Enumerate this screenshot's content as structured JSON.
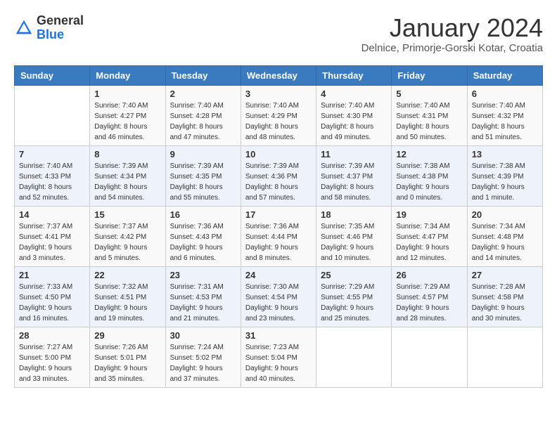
{
  "header": {
    "logo_general": "General",
    "logo_blue": "Blue",
    "month_year": "January 2024",
    "location": "Delnice, Primorje-Gorski Kotar, Croatia"
  },
  "weekdays": [
    "Sunday",
    "Monday",
    "Tuesday",
    "Wednesday",
    "Thursday",
    "Friday",
    "Saturday"
  ],
  "weeks": [
    [
      {
        "day": "",
        "sunrise": "",
        "sunset": "",
        "daylight": ""
      },
      {
        "day": "1",
        "sunrise": "Sunrise: 7:40 AM",
        "sunset": "Sunset: 4:27 PM",
        "daylight": "Daylight: 8 hours and 46 minutes."
      },
      {
        "day": "2",
        "sunrise": "Sunrise: 7:40 AM",
        "sunset": "Sunset: 4:28 PM",
        "daylight": "Daylight: 8 hours and 47 minutes."
      },
      {
        "day": "3",
        "sunrise": "Sunrise: 7:40 AM",
        "sunset": "Sunset: 4:29 PM",
        "daylight": "Daylight: 8 hours and 48 minutes."
      },
      {
        "day": "4",
        "sunrise": "Sunrise: 7:40 AM",
        "sunset": "Sunset: 4:30 PM",
        "daylight": "Daylight: 8 hours and 49 minutes."
      },
      {
        "day": "5",
        "sunrise": "Sunrise: 7:40 AM",
        "sunset": "Sunset: 4:31 PM",
        "daylight": "Daylight: 8 hours and 50 minutes."
      },
      {
        "day": "6",
        "sunrise": "Sunrise: 7:40 AM",
        "sunset": "Sunset: 4:32 PM",
        "daylight": "Daylight: 8 hours and 51 minutes."
      }
    ],
    [
      {
        "day": "7",
        "sunrise": "Sunrise: 7:40 AM",
        "sunset": "Sunset: 4:33 PM",
        "daylight": "Daylight: 8 hours and 52 minutes."
      },
      {
        "day": "8",
        "sunrise": "Sunrise: 7:39 AM",
        "sunset": "Sunset: 4:34 PM",
        "daylight": "Daylight: 8 hours and 54 minutes."
      },
      {
        "day": "9",
        "sunrise": "Sunrise: 7:39 AM",
        "sunset": "Sunset: 4:35 PM",
        "daylight": "Daylight: 8 hours and 55 minutes."
      },
      {
        "day": "10",
        "sunrise": "Sunrise: 7:39 AM",
        "sunset": "Sunset: 4:36 PM",
        "daylight": "Daylight: 8 hours and 57 minutes."
      },
      {
        "day": "11",
        "sunrise": "Sunrise: 7:39 AM",
        "sunset": "Sunset: 4:37 PM",
        "daylight": "Daylight: 8 hours and 58 minutes."
      },
      {
        "day": "12",
        "sunrise": "Sunrise: 7:38 AM",
        "sunset": "Sunset: 4:38 PM",
        "daylight": "Daylight: 9 hours and 0 minutes."
      },
      {
        "day": "13",
        "sunrise": "Sunrise: 7:38 AM",
        "sunset": "Sunset: 4:39 PM",
        "daylight": "Daylight: 9 hours and 1 minute."
      }
    ],
    [
      {
        "day": "14",
        "sunrise": "Sunrise: 7:37 AM",
        "sunset": "Sunset: 4:41 PM",
        "daylight": "Daylight: 9 hours and 3 minutes."
      },
      {
        "day": "15",
        "sunrise": "Sunrise: 7:37 AM",
        "sunset": "Sunset: 4:42 PM",
        "daylight": "Daylight: 9 hours and 5 minutes."
      },
      {
        "day": "16",
        "sunrise": "Sunrise: 7:36 AM",
        "sunset": "Sunset: 4:43 PM",
        "daylight": "Daylight: 9 hours and 6 minutes."
      },
      {
        "day": "17",
        "sunrise": "Sunrise: 7:36 AM",
        "sunset": "Sunset: 4:44 PM",
        "daylight": "Daylight: 9 hours and 8 minutes."
      },
      {
        "day": "18",
        "sunrise": "Sunrise: 7:35 AM",
        "sunset": "Sunset: 4:46 PM",
        "daylight": "Daylight: 9 hours and 10 minutes."
      },
      {
        "day": "19",
        "sunrise": "Sunrise: 7:34 AM",
        "sunset": "Sunset: 4:47 PM",
        "daylight": "Daylight: 9 hours and 12 minutes."
      },
      {
        "day": "20",
        "sunrise": "Sunrise: 7:34 AM",
        "sunset": "Sunset: 4:48 PM",
        "daylight": "Daylight: 9 hours and 14 minutes."
      }
    ],
    [
      {
        "day": "21",
        "sunrise": "Sunrise: 7:33 AM",
        "sunset": "Sunset: 4:50 PM",
        "daylight": "Daylight: 9 hours and 16 minutes."
      },
      {
        "day": "22",
        "sunrise": "Sunrise: 7:32 AM",
        "sunset": "Sunset: 4:51 PM",
        "daylight": "Daylight: 9 hours and 19 minutes."
      },
      {
        "day": "23",
        "sunrise": "Sunrise: 7:31 AM",
        "sunset": "Sunset: 4:53 PM",
        "daylight": "Daylight: 9 hours and 21 minutes."
      },
      {
        "day": "24",
        "sunrise": "Sunrise: 7:30 AM",
        "sunset": "Sunset: 4:54 PM",
        "daylight": "Daylight: 9 hours and 23 minutes."
      },
      {
        "day": "25",
        "sunrise": "Sunrise: 7:29 AM",
        "sunset": "Sunset: 4:55 PM",
        "daylight": "Daylight: 9 hours and 25 minutes."
      },
      {
        "day": "26",
        "sunrise": "Sunrise: 7:29 AM",
        "sunset": "Sunset: 4:57 PM",
        "daylight": "Daylight: 9 hours and 28 minutes."
      },
      {
        "day": "27",
        "sunrise": "Sunrise: 7:28 AM",
        "sunset": "Sunset: 4:58 PM",
        "daylight": "Daylight: 9 hours and 30 minutes."
      }
    ],
    [
      {
        "day": "28",
        "sunrise": "Sunrise: 7:27 AM",
        "sunset": "Sunset: 5:00 PM",
        "daylight": "Daylight: 9 hours and 33 minutes."
      },
      {
        "day": "29",
        "sunrise": "Sunrise: 7:26 AM",
        "sunset": "Sunset: 5:01 PM",
        "daylight": "Daylight: 9 hours and 35 minutes."
      },
      {
        "day": "30",
        "sunrise": "Sunrise: 7:24 AM",
        "sunset": "Sunset: 5:02 PM",
        "daylight": "Daylight: 9 hours and 37 minutes."
      },
      {
        "day": "31",
        "sunrise": "Sunrise: 7:23 AM",
        "sunset": "Sunset: 5:04 PM",
        "daylight": "Daylight: 9 hours and 40 minutes."
      },
      {
        "day": "",
        "sunrise": "",
        "sunset": "",
        "daylight": ""
      },
      {
        "day": "",
        "sunrise": "",
        "sunset": "",
        "daylight": ""
      },
      {
        "day": "",
        "sunrise": "",
        "sunset": "",
        "daylight": ""
      }
    ]
  ]
}
